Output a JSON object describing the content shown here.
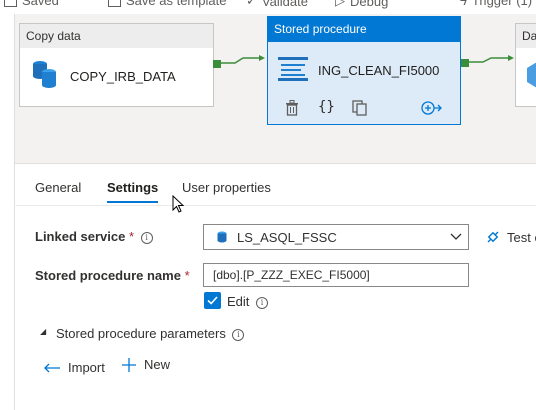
{
  "toolbar": {
    "saved_label": "Saved",
    "save_template_label": "Save as template",
    "validate_label": "Validate",
    "debug_label": "Debug",
    "trigger_label": "Trigger (1)"
  },
  "canvas": {
    "copy_activity": {
      "type_label": "Copy data",
      "name": "COPY_IRB_DATA"
    },
    "sp_activity": {
      "type_label": "Stored procedure",
      "name": "ING_CLEAN_FI5000"
    },
    "next_activity": {
      "type_label": "Da"
    }
  },
  "tabs": [
    {
      "label": "General"
    },
    {
      "label": "Settings",
      "active": true
    },
    {
      "label": "User properties"
    }
  ],
  "settings": {
    "linked_service_label": "Linked service",
    "linked_service_value": "LS_ASQL_FSSC",
    "test_connection_label": "Test c",
    "sp_name_label": "Stored procedure name",
    "sp_name_value": "[dbo].[P_ZZZ_EXEC_FI5000]",
    "edit_label": "Edit",
    "edit_checked": true,
    "params_section_label": "Stored procedure parameters",
    "import_label": "Import",
    "new_label": "New"
  },
  "colors": {
    "accent": "#0078d4",
    "connector": "#3a8e3a",
    "required": "#a4262c"
  }
}
